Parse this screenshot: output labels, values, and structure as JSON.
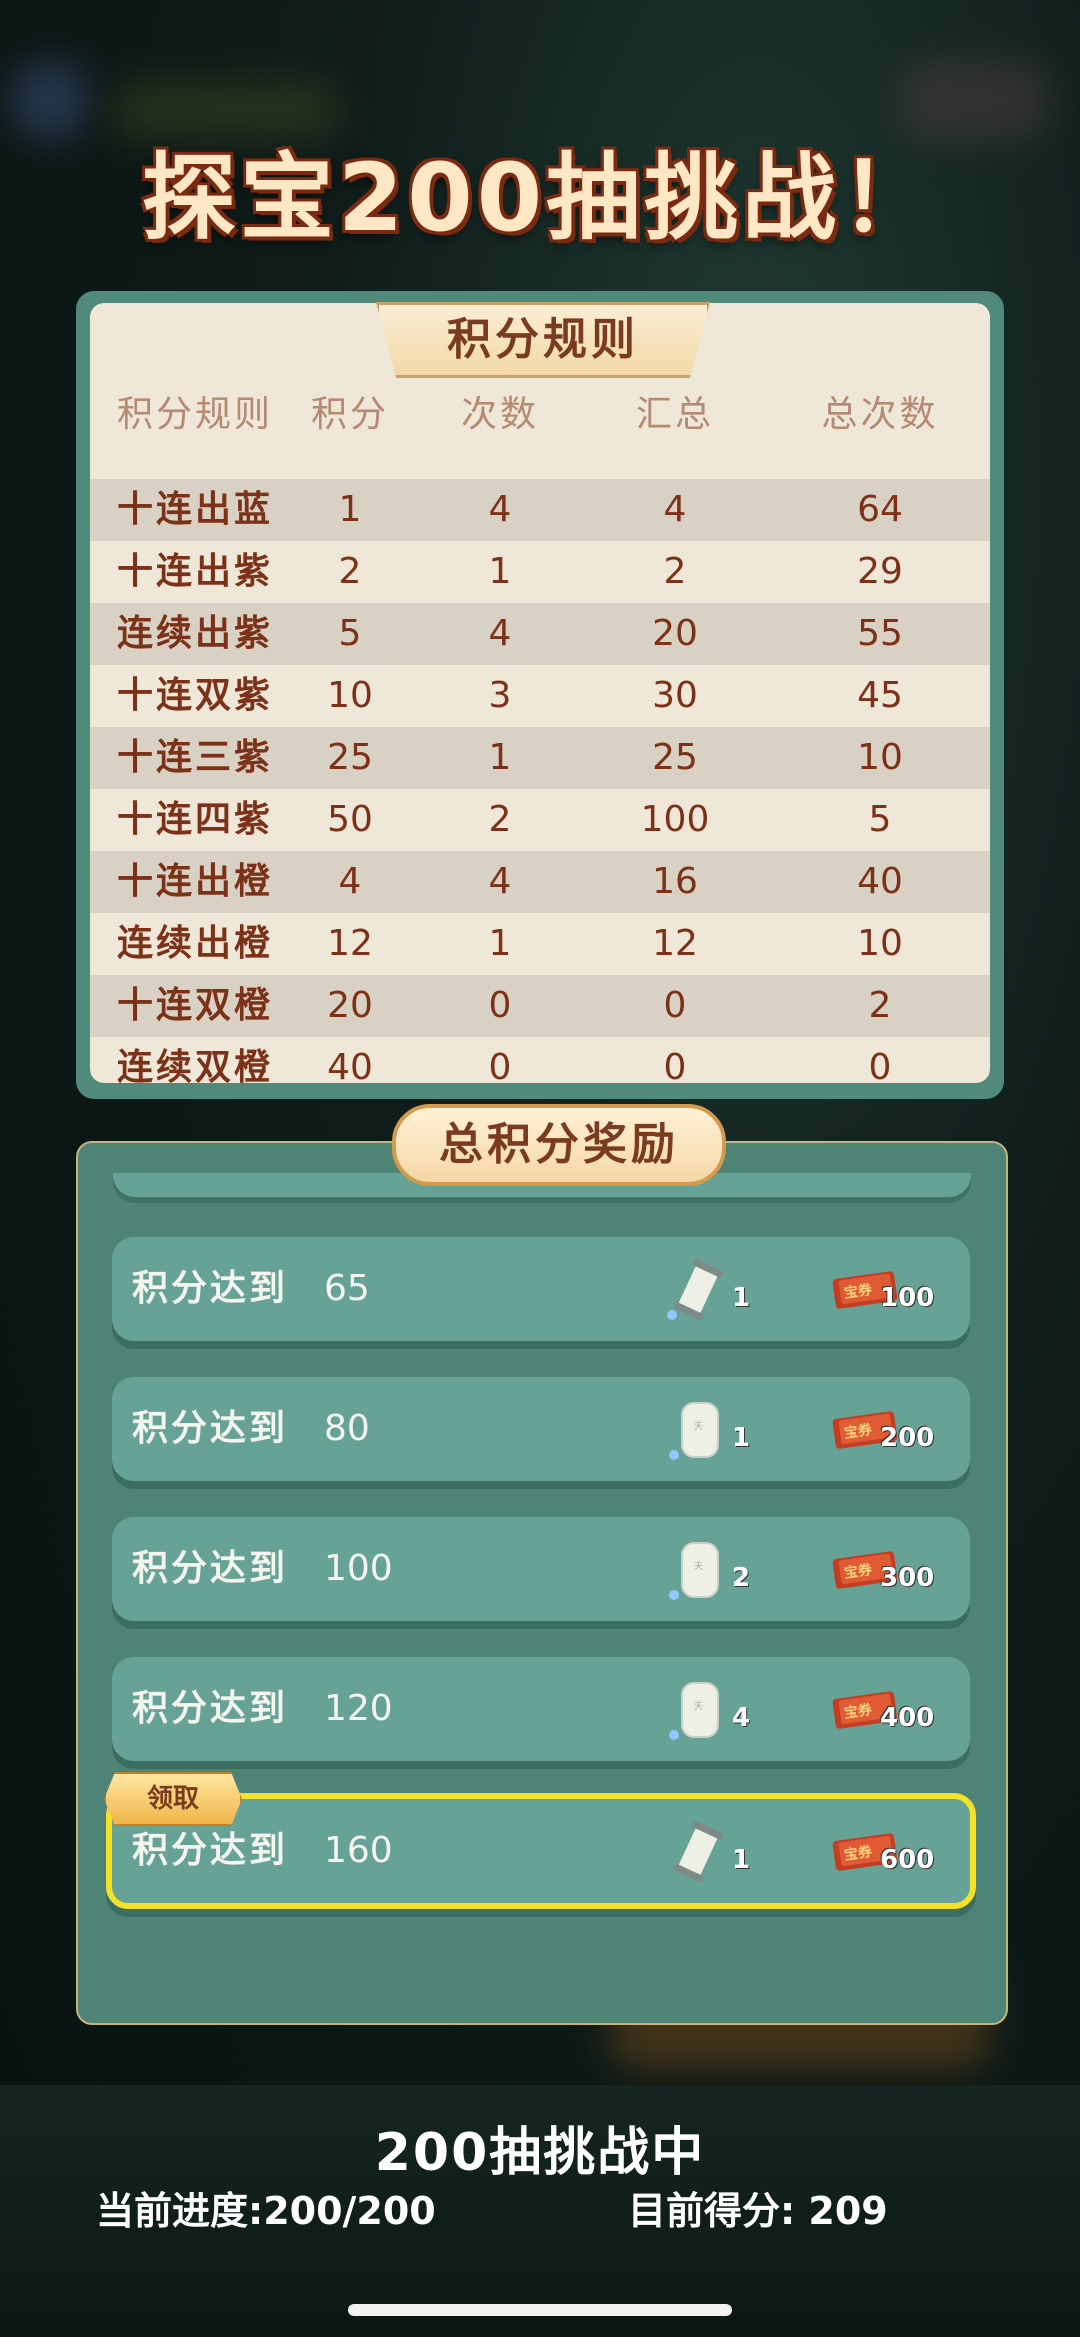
{
  "title": "探宝200抽挑战！",
  "rules": {
    "tab_label": "积分规则",
    "headers": [
      "积分规则",
      "积分",
      "次数",
      "汇总",
      "总次数"
    ],
    "rows": [
      [
        "十连出蓝",
        "1",
        "4",
        "4",
        "64"
      ],
      [
        "十连出紫",
        "2",
        "1",
        "2",
        "29"
      ],
      [
        "连续出紫",
        "5",
        "4",
        "20",
        "55"
      ],
      [
        "十连双紫",
        "10",
        "3",
        "30",
        "45"
      ],
      [
        "十连三紫",
        "25",
        "1",
        "25",
        "10"
      ],
      [
        "十连四紫",
        "50",
        "2",
        "100",
        "5"
      ],
      [
        "十连出橙",
        "4",
        "4",
        "16",
        "40"
      ],
      [
        "连续出橙",
        "12",
        "1",
        "12",
        "10"
      ],
      [
        "十连双橙",
        "20",
        "0",
        "0",
        "2"
      ],
      [
        "连续双橙",
        "40",
        "0",
        "0",
        "0"
      ]
    ]
  },
  "rewards": {
    "tab_label": "总积分奖励",
    "prefix": "积分达到",
    "claim_label": "领取",
    "items": [
      {
        "threshold": "65",
        "item_icon": "scroll-icon",
        "item_qty": "1",
        "coupon_icon": "treasure-coupon-icon",
        "coupon_qty": "100",
        "active": false
      },
      {
        "threshold": "80",
        "item_icon": "jade-tablet-icon",
        "item_qty": "1",
        "coupon_icon": "treasure-coupon-icon",
        "coupon_qty": "200",
        "active": false
      },
      {
        "threshold": "100",
        "item_icon": "jade-tablet-icon",
        "item_qty": "2",
        "coupon_icon": "treasure-coupon-icon",
        "coupon_qty": "300",
        "active": false
      },
      {
        "threshold": "120",
        "item_icon": "jade-tablet-icon",
        "item_qty": "4",
        "coupon_icon": "treasure-coupon-icon",
        "coupon_qty": "400",
        "active": false
      },
      {
        "threshold": "160",
        "item_icon": "scroll-icon",
        "item_qty": "1",
        "coupon_icon": "treasure-coupon-icon",
        "coupon_qty": "600",
        "active": true
      }
    ]
  },
  "footer": {
    "status": "200抽挑战中",
    "progress": "当前进度:200/200",
    "score": "目前得分: 209"
  },
  "colors": {
    "panel_green": "#4f8a7a",
    "row_green": "#66a295",
    "table_bg": "#efe7d8",
    "table_text": "#7c3219",
    "highlight": "#f3e228"
  }
}
